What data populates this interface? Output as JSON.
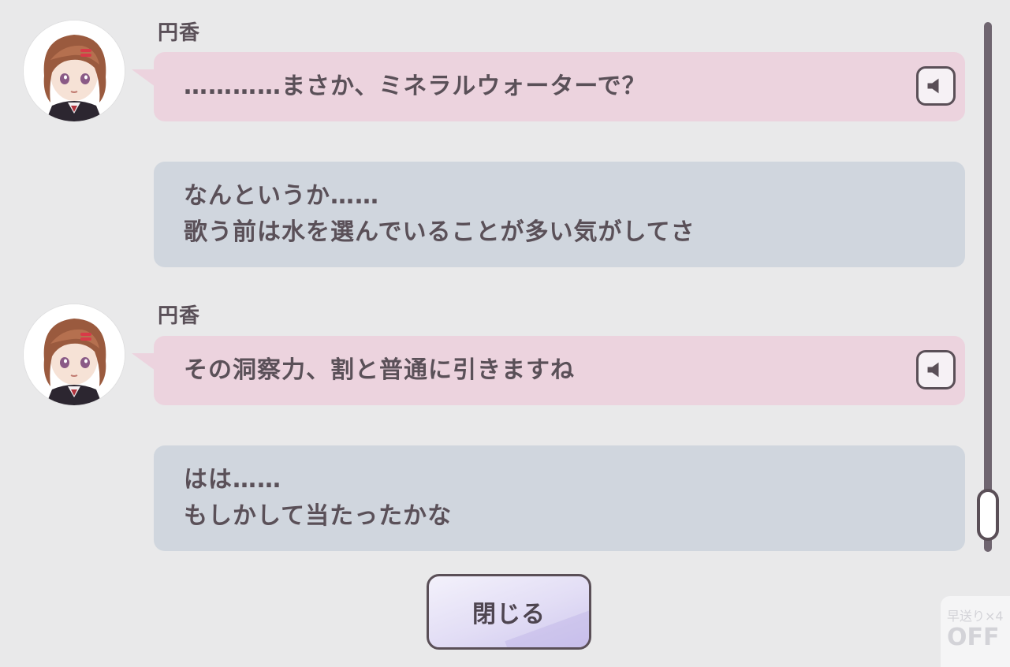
{
  "messages": [
    {
      "type": "character",
      "speaker": "円香",
      "text": "…………まさか、ミネラルウォーターで？",
      "voice_icon": "speaker-icon"
    },
    {
      "type": "player",
      "lines": [
        "なんというか……",
        "歌う前は水を選んでいることが多い気がしてさ"
      ]
    },
    {
      "type": "character",
      "speaker": "円香",
      "text": "その洞察力、割と普通に引きますね",
      "voice_icon": "speaker-icon"
    },
    {
      "type": "player",
      "lines": [
        "はは……",
        "もしかして当たったかな"
      ]
    }
  ],
  "close_button": {
    "label": "閉じる"
  },
  "fast_forward": {
    "label": "早送り×4",
    "state": "OFF"
  },
  "colors": {
    "background": "#e9e9ea",
    "character_bubble": "#ecd3de",
    "player_bubble": "#d0d6de",
    "text": "#5a5058",
    "scrollbar": "#6f6570"
  }
}
